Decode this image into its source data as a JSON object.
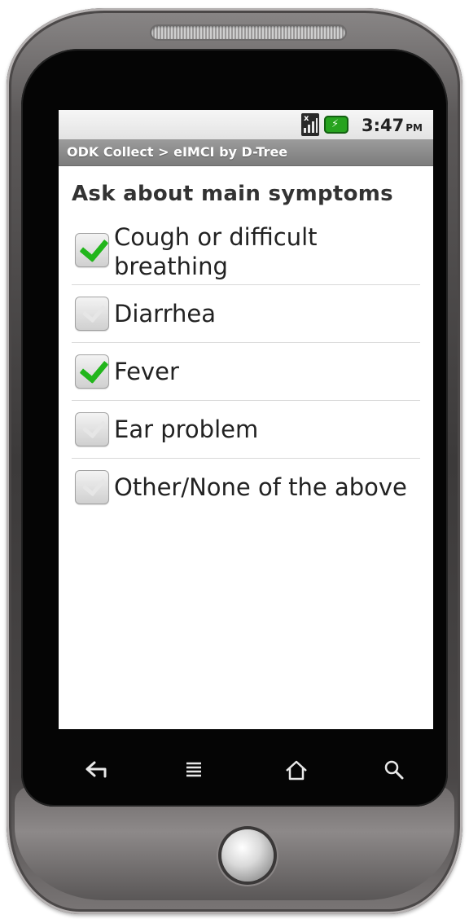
{
  "status_bar": {
    "time": "3:47",
    "ampm": "PM",
    "icons": [
      "signal-icon",
      "battery-charging-icon"
    ],
    "battery_color": "#27a31f"
  },
  "title_bar": {
    "title": "ODK Collect > eIMCI by D-Tree"
  },
  "form": {
    "question": "Ask about main symptoms",
    "options": [
      {
        "label_line1": "Cough or difficult",
        "label_line2": "breathing",
        "checked": true
      },
      {
        "label_line1": "Diarrhea",
        "checked": false
      },
      {
        "label_line1": "Fever",
        "checked": true
      },
      {
        "label_line1": "Ear problem",
        "checked": false
      },
      {
        "label_line1": "Other/None of the above",
        "checked": false
      }
    ],
    "check_color": "#22b61c"
  },
  "softkeys": [
    "back-icon",
    "menu-icon",
    "home-icon",
    "search-icon"
  ]
}
